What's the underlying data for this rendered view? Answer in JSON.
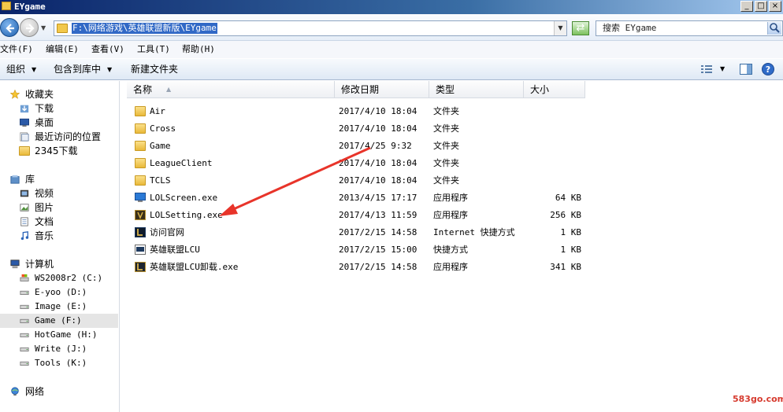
{
  "window": {
    "title": "EYgame",
    "controls": [
      "_",
      "□",
      "×"
    ]
  },
  "address": {
    "path": "F:\\网络游戏\\英雄联盟新版\\EYgame"
  },
  "search": {
    "placeholder": "搜索 EYgame"
  },
  "menu": [
    "文件(F)",
    "编辑(E)",
    "查看(V)",
    "工具(T)",
    "帮助(H)"
  ],
  "toolbar": {
    "organize": "组织",
    "include": "包含到库中",
    "new_folder": "新建文件夹"
  },
  "sidebar": {
    "favorites": {
      "label": "收藏夹",
      "items": [
        "下载",
        "桌面",
        "最近访问的位置",
        "2345下载"
      ]
    },
    "libraries": {
      "label": "库",
      "items": [
        "视频",
        "图片",
        "文档",
        "音乐"
      ]
    },
    "computer": {
      "label": "计算机",
      "drives": [
        "WS2008r2 (C:)",
        "E-yoo (D:)",
        "Image (E:)",
        "Game (F:)",
        "HotGame (H:)",
        "Write (J:)",
        "Tools (K:)"
      ],
      "selected_index": 3
    },
    "network": {
      "label": "网络"
    }
  },
  "columns": {
    "name": "名称",
    "modified": "修改日期",
    "type": "类型",
    "size": "大小"
  },
  "files": [
    {
      "name": "Air",
      "modified": "2017/4/10 18:04",
      "type": "文件夹",
      "size": "",
      "icon": "folder-icon"
    },
    {
      "name": "Cross",
      "modified": "2017/4/10 18:04",
      "type": "文件夹",
      "size": "",
      "icon": "folder-icon"
    },
    {
      "name": "Game",
      "modified": "2017/4/25 9:32",
      "type": "文件夹",
      "size": "",
      "icon": "folder-icon"
    },
    {
      "name": "LeagueClient",
      "modified": "2017/4/10 18:04",
      "type": "文件夹",
      "size": "",
      "icon": "folder-icon"
    },
    {
      "name": "TCLS",
      "modified": "2017/4/10 18:04",
      "type": "文件夹",
      "size": "",
      "icon": "folder-icon"
    },
    {
      "name": "LOLScreen.exe",
      "modified": "2013/4/15 17:17",
      "type": "应用程序",
      "size": "64 KB",
      "icon": "monitor-app-icon"
    },
    {
      "name": "LOLSetting.exe",
      "modified": "2017/4/13 11:59",
      "type": "应用程序",
      "size": "256 KB",
      "icon": "game-app-icon"
    },
    {
      "name": "访问官网",
      "modified": "2017/2/15 14:58",
      "type": "Internet 快捷方式",
      "size": "1 KB",
      "icon": "web-shortcut-icon"
    },
    {
      "name": "英雄联盟LCU",
      "modified": "2017/2/15 15:00",
      "type": "快捷方式",
      "size": "1 KB",
      "icon": "shortcut-icon"
    },
    {
      "name": "英雄联盟LCU卸载.exe",
      "modified": "2017/2/15 14:58",
      "type": "应用程序",
      "size": "341 KB",
      "icon": "uninstall-app-icon"
    }
  ],
  "watermark": "583go.com",
  "colors": {
    "accent": "#e8342a",
    "selection": "#3169c6"
  }
}
